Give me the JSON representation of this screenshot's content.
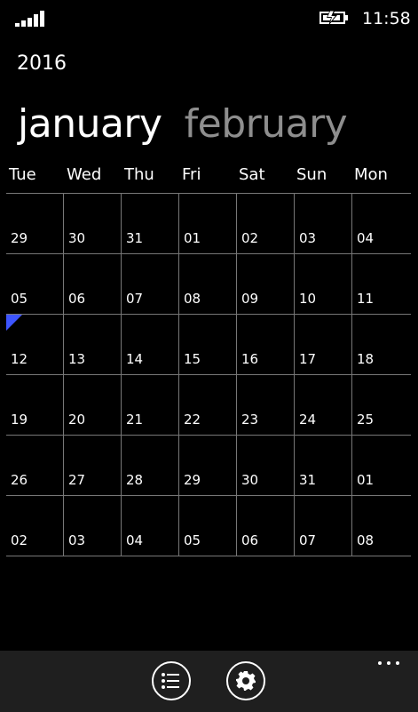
{
  "status_bar": {
    "signal_icon": "cellular-signal-icon",
    "battery_icon": "battery-charging-icon",
    "time": "11:58"
  },
  "calendar": {
    "year": "2016",
    "pivot": {
      "active_month": "january",
      "next_month": "february"
    },
    "weekdays": [
      "Tue",
      "Wed",
      "Thu",
      "Fri",
      "Sat",
      "Sun",
      "Mon"
    ],
    "weeks": [
      [
        "29",
        "30",
        "31",
        "01",
        "02",
        "03",
        "04"
      ],
      [
        "05",
        "06",
        "07",
        "08",
        "09",
        "10",
        "11"
      ],
      [
        "12",
        "13",
        "14",
        "15",
        "16",
        "17",
        "18"
      ],
      [
        "19",
        "20",
        "21",
        "22",
        "23",
        "24",
        "25"
      ],
      [
        "26",
        "27",
        "28",
        "29",
        "30",
        "31",
        "01"
      ],
      [
        "02",
        "03",
        "04",
        "05",
        "06",
        "07",
        "08"
      ]
    ],
    "today_marker_color": "#3d55ff"
  },
  "app_bar": {
    "list_icon": "list-icon",
    "settings_icon": "settings-gear-icon",
    "more_icon": "more-options-icon",
    "background_color": "#1f1f1f"
  }
}
